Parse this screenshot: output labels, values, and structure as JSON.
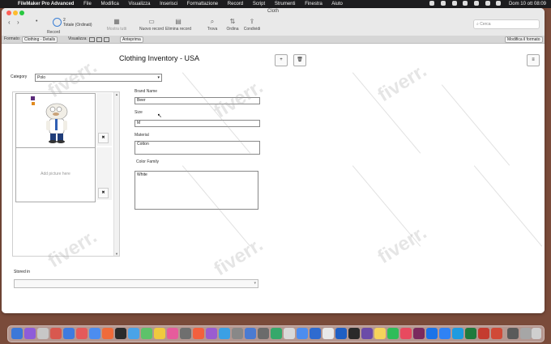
{
  "menubar": {
    "app_name": "FileMaker Pro Advanced",
    "items": [
      "File",
      "Modifica",
      "Visualizza",
      "Inserisci",
      "Formattazione",
      "Record",
      "Script",
      "Strumenti",
      "Finestra",
      "Aiuto"
    ],
    "clock": "Dom 10 ott  08:09"
  },
  "window": {
    "title": "Cloth"
  },
  "toolbar": {
    "record_count": "2",
    "record_total": "Totale (Ordinati)",
    "record_label": "Record",
    "show_all_label": "Mostra tutti",
    "new_record_label": "Nuovo record",
    "delete_record_label": "Elimina record",
    "find_label": "Trova",
    "sort_label": "Ordina",
    "share_label": "Condividi",
    "search_placeholder": "Cerca"
  },
  "layoutbar": {
    "format_label": "Formato:",
    "layout_name": "Clothing - Details",
    "view_label": "Visualizza:",
    "preview_label": "Anteprima",
    "edit_layout_label": "Modifica il formato"
  },
  "form": {
    "title": "Clothing Inventory - USA",
    "add_button": "+",
    "trash_button": "🗑",
    "menu_button": "≡",
    "category_label": "Category",
    "category_value": "Polo",
    "add_picture_placeholder": "Add picture here",
    "brand_label": "Brand Name",
    "brand_value": "Beer",
    "size_label": "Size",
    "size_value": "M",
    "material_label": "Material",
    "material_value": "Cotton",
    "color_label": "Color Family",
    "color_value": "White",
    "stored_label": "Stored in",
    "stored_value": ""
  },
  "watermark": "fiverr.",
  "colors": {
    "close": "#ff5f57",
    "minimize": "#febc2e",
    "maximize": "#28c840",
    "accent": "#3a7fd6"
  }
}
